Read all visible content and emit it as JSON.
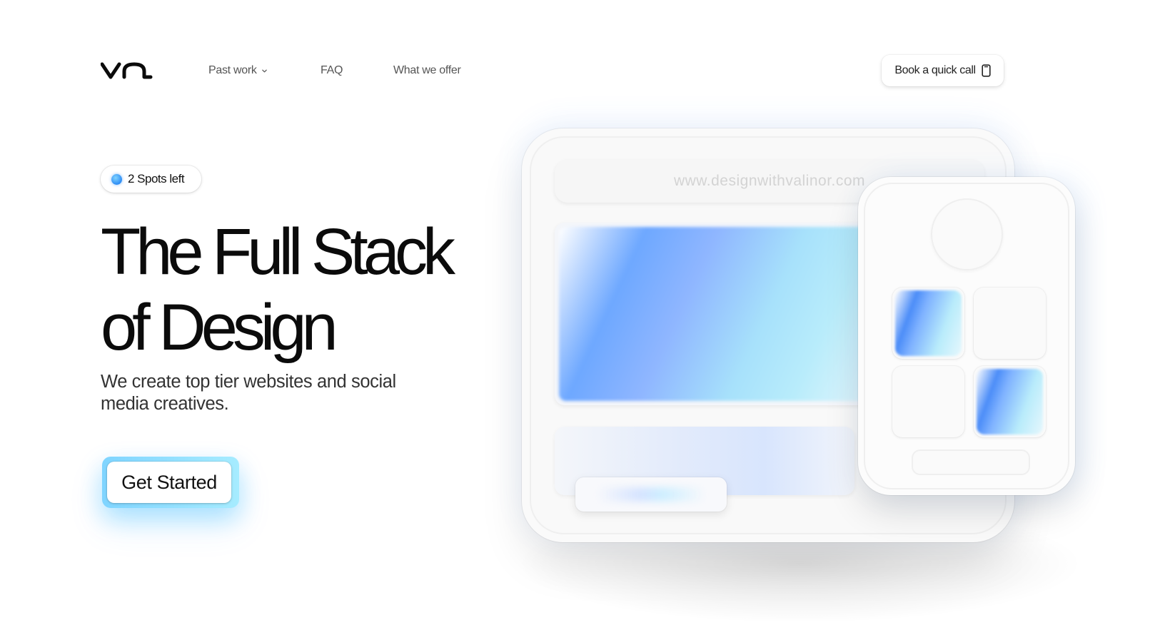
{
  "nav": {
    "logo_text": "va",
    "items": [
      {
        "label": "Past work",
        "has_dropdown": true
      },
      {
        "label": "FAQ",
        "has_dropdown": false
      },
      {
        "label": "What we offer",
        "has_dropdown": false
      }
    ],
    "book_button_label": "Book a quick call",
    "book_button_icon": "phone-icon"
  },
  "hero": {
    "badge_label": "2 Spots left",
    "headline_line1": "The Full Stack",
    "headline_line2": "of Design",
    "subtitle": "We create top tier websites and social media creatives.",
    "cta_label": "Get Started"
  },
  "mockup": {
    "url": "www.designwithvalinor.com"
  },
  "colors": {
    "accent_blue": "#2e8df5",
    "glow_cyan": "#00aaff",
    "text_dark": "#0b0b0b",
    "nav_text": "#555555"
  }
}
